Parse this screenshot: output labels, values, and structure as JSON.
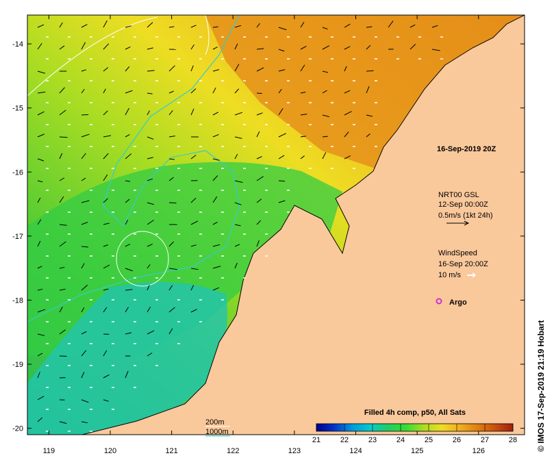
{
  "map": {
    "lon_range": [
      118.65,
      126.75
    ],
    "lat_range": [
      -20.1,
      -13.55
    ],
    "lon_ticks": [
      "119",
      "120",
      "121",
      "122",
      "123",
      "124",
      "125",
      "126"
    ],
    "lat_ticks": [
      "-14",
      "-15",
      "-16",
      "-17",
      "-18",
      "-19",
      "-20"
    ],
    "land_color": "#f9c89b",
    "current_line_color": "#33cccc",
    "contour_color": "#ffffff"
  },
  "date_title": "16-Sep-2019 20Z",
  "currents_legend": {
    "title": "NRT00 GSL",
    "date": "12-Sep 00:00Z",
    "scale": "0.5m/s (1kt 24h)"
  },
  "wind_legend": {
    "title": "WindSpeed",
    "date": "16-Sep 20:00Z",
    "scale": "10 m/s"
  },
  "argo_label": "Argo",
  "argo_color": "#cc33cc",
  "bathymetry": {
    "depth_200": "200m",
    "depth_1000": "1000m"
  },
  "colorbar": {
    "title": "Filled 4h comp, p50, All Sats",
    "labels": [
      "21",
      "22",
      "23",
      "24",
      "25",
      "26",
      "27",
      "28"
    ],
    "colors": [
      "#00008b",
      "#0033cc",
      "#0099dd",
      "#00cccc",
      "#22cc66",
      "#33dd33",
      "#aadd22",
      "#eedd22",
      "#f0b020",
      "#e08010",
      "#c85010",
      "#a02010"
    ]
  },
  "copyright": "© IMOS 17-Sep-2019 21:19 Hobart"
}
